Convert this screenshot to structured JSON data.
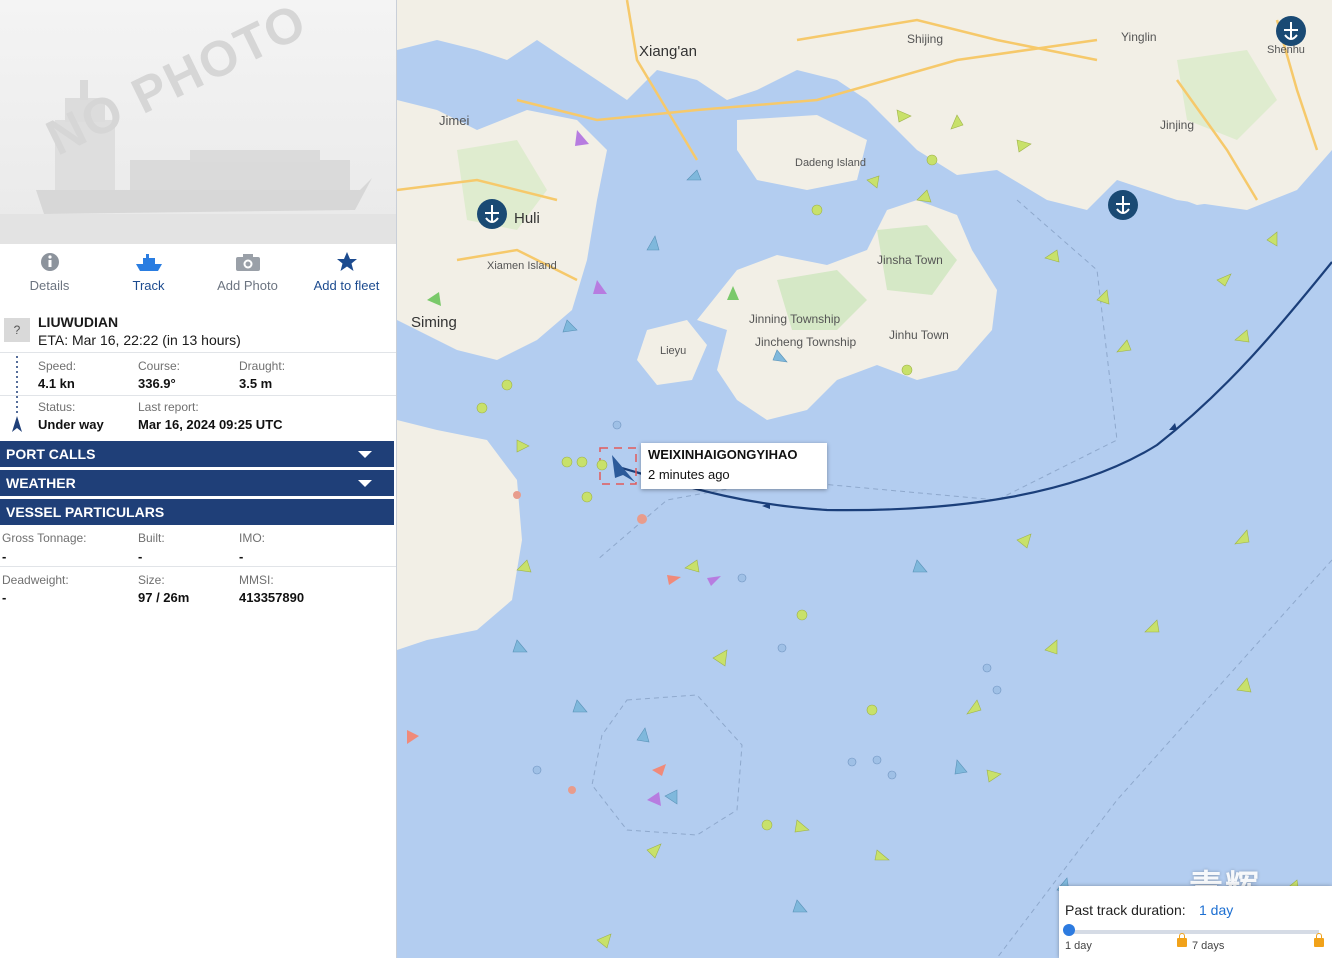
{
  "photo": {
    "placeholder_text": "NO PHOTO"
  },
  "actions": [
    {
      "label": "Details",
      "icon": "info-icon"
    },
    {
      "label": "Track",
      "icon": "ship-icon"
    },
    {
      "label": "Add Photo",
      "icon": "camera-icon"
    },
    {
      "label": "Add to fleet",
      "icon": "star-icon"
    }
  ],
  "voyage": {
    "flag": "?",
    "destination": "LIUWUDIAN",
    "eta": "ETA: Mar 16, 22:22 (in 13 hours)"
  },
  "status": {
    "speed_label": "Speed:",
    "speed": "4.1 kn",
    "course_label": "Course:",
    "course": "336.9°",
    "draught_label": "Draught:",
    "draught": "3.5 m",
    "status_label": "Status:",
    "status": "Under way",
    "last_report_label": "Last report:",
    "last_report": "Mar 16, 2024 09:25 UTC"
  },
  "sections": {
    "port_calls": "PORT CALLS",
    "weather": "WEATHER",
    "vessel_particulars": "VESSEL PARTICULARS"
  },
  "particulars": {
    "gross_tonnage_label": "Gross Tonnage:",
    "gross_tonnage": "-",
    "built_label": "Built:",
    "built": "-",
    "imo_label": "IMO:",
    "imo": "-",
    "deadweight_label": "Deadweight:",
    "deadweight": "-",
    "size_label": "Size:",
    "size": "97 / 26m",
    "mmsi_label": "MMSI:",
    "mmsi": "413357890"
  },
  "map": {
    "places": [
      "Xiang'an",
      "Jimei",
      "Huli",
      "Xiamen Island",
      "Siming",
      "Dadeng Island",
      "Jinsha Town",
      "Jinning Township",
      "Jincheng Township",
      "Jinhu Town",
      "Lieyu",
      "Yinglin",
      "Jinjing",
      "Shijing",
      "Shenhu"
    ],
    "popup": {
      "vessel_name": "WEIXINHAIGONGYIHAO",
      "time_ago": "2 minutes ago"
    },
    "track_duration": {
      "label": "Past track duration:",
      "value": "1 day",
      "min_label": "1 day",
      "mid_label": "7 days"
    },
    "colors": {
      "sea": "#b3cdf0",
      "land": "#f2efe6",
      "track": "#1b3f7a",
      "cargo": "#c8e16a"
    }
  },
  "watermark": "青辉"
}
